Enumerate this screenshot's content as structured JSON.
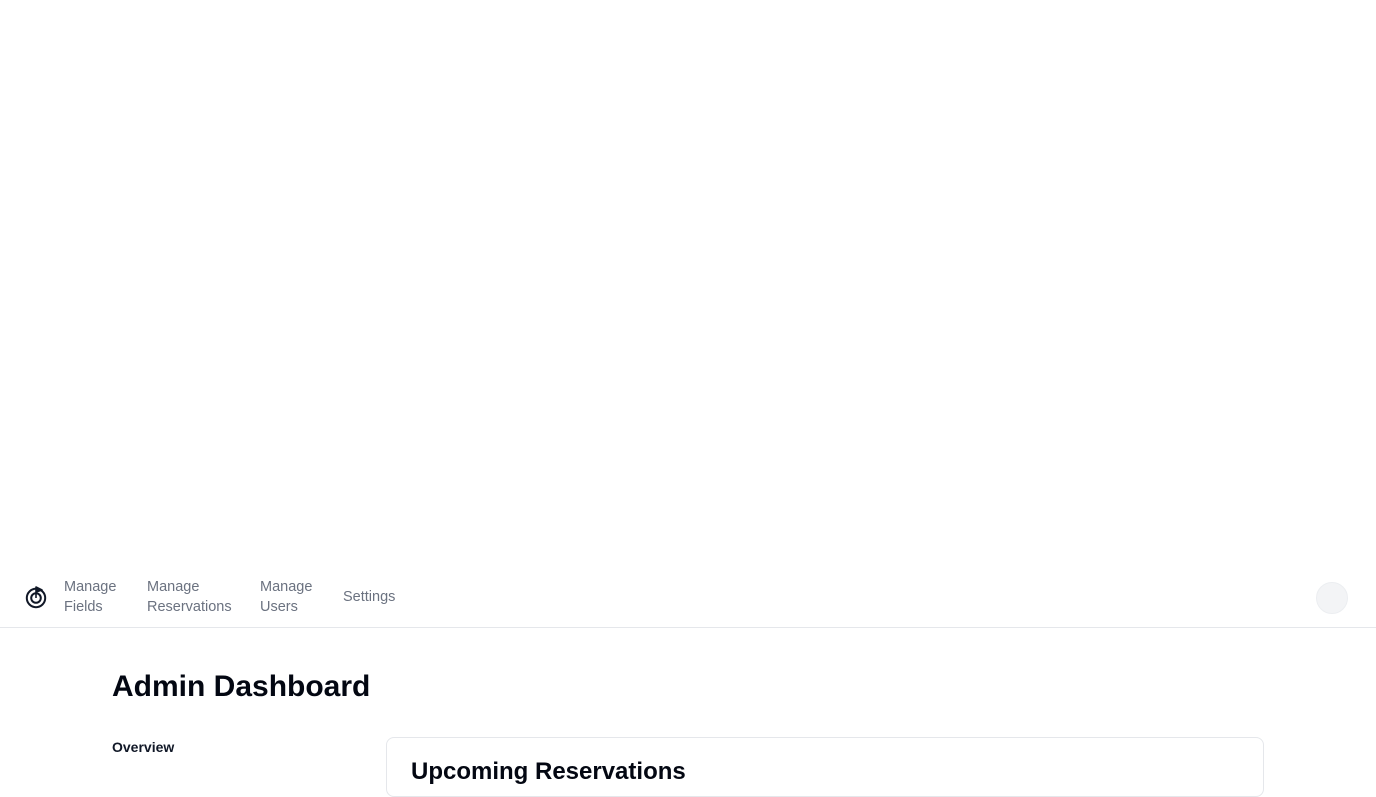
{
  "nav": {
    "items": [
      {
        "label_line1": "Manage",
        "label_line2": "Fields"
      },
      {
        "label_line1": "Manage",
        "label_line2": "Reservations"
      },
      {
        "label_line1": "Manage",
        "label_line2": "Users"
      },
      {
        "label": "Settings"
      }
    ],
    "logo_icon": "logo-icon",
    "avatar_icon": "avatar"
  },
  "page": {
    "title": "Admin Dashboard"
  },
  "sidebar": {
    "items": [
      {
        "label": "Overview"
      }
    ]
  },
  "card": {
    "title": "Upcoming Reservations"
  },
  "colors": {
    "nav_text": "#6b7280",
    "border": "#e5e7eb",
    "heading": "#030712"
  }
}
